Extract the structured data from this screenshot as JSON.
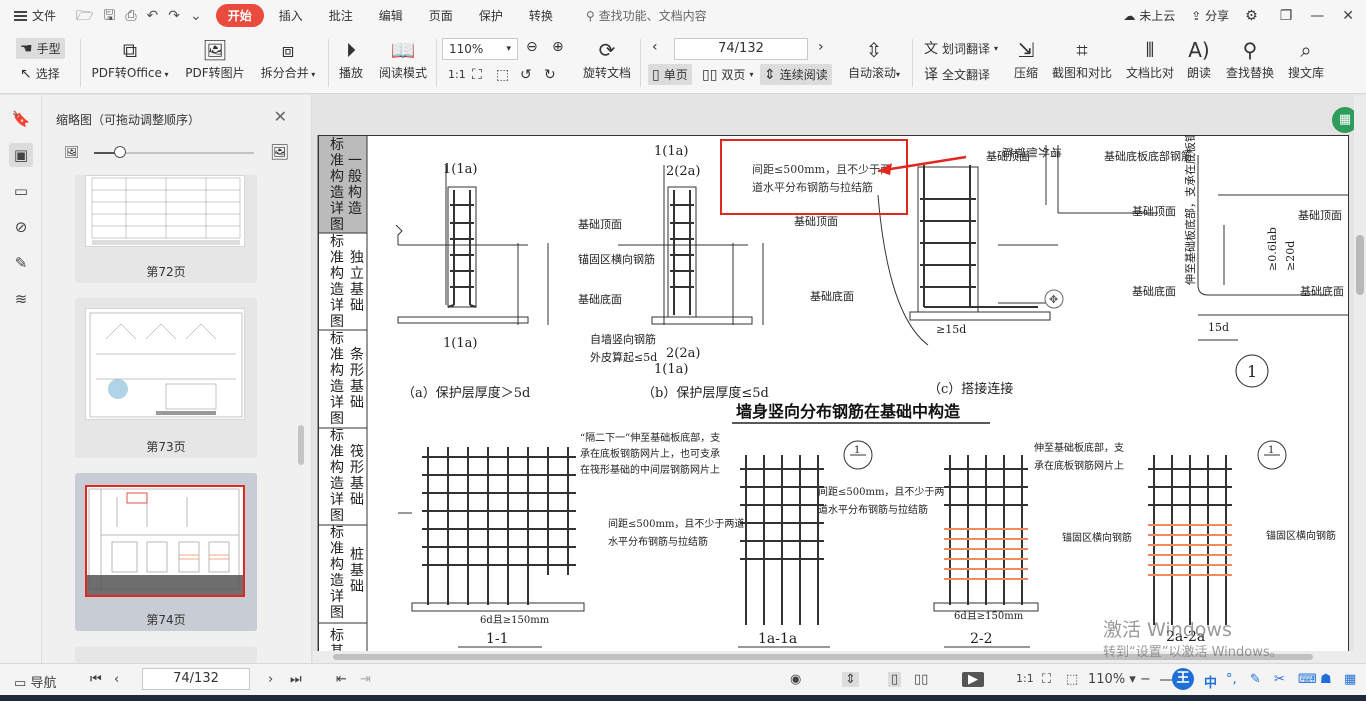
{
  "menubar": {
    "file": "文件",
    "tabs": [
      "开始",
      "插入",
      "批注",
      "编辑",
      "页面",
      "保护",
      "转换"
    ],
    "active_tab": "开始",
    "search_placeholder": "查找功能、文档内容",
    "cloud": "未上云",
    "share": "分享"
  },
  "ribbon": {
    "hand": "手型",
    "select": "选择",
    "pdf_to_office": "PDF转Office",
    "pdf_to_image": "PDF转图片",
    "split_merge": "拆分合并",
    "play": "播放",
    "read_mode": "阅读模式",
    "zoom": "110%",
    "rotate_doc": "旋转文档",
    "page_field": "74/132",
    "single": "单页",
    "double": "双页",
    "continuous": "连续阅读",
    "auto_scroll": "自动滚动",
    "word_translate": "划词翻译",
    "full_translate": "全文翻译",
    "compress": "压缩",
    "screenshot_compare": "截图和对比",
    "doc_compare": "文档比对",
    "read_aloud": "朗读",
    "find_replace": "查找替换",
    "search_lib": "搜文库"
  },
  "thumbnails": {
    "title": "缩略图（可拖动调整顺序）",
    "pages": [
      {
        "label": "第72页",
        "selected": false
      },
      {
        "label": "第73页",
        "selected": false
      },
      {
        "label": "第74页",
        "selected": true
      }
    ]
  },
  "document": {
    "side_column": [
      "标准构造详图",
      "一般构造",
      "标准构造详图",
      "独立基础",
      "标准构造详图",
      "条形基础",
      "标准构造详图",
      "筏形基础",
      "标准构造详图",
      "桩基础",
      "标基"
    ],
    "annotation_box": "间距≤500mm，且不少于两道水平分布钢筋与拉结筋",
    "heading": "墙身竖向分布钢筋在基础中构造",
    "captions": [
      "（a）保护层厚度＞5d",
      "（b）保护层厚度≤5d",
      "（c）搭接连接"
    ],
    "labels": {
      "sec_1a": "1(1a)",
      "sec_2a": "2(2a)",
      "found_top": "基础顶面",
      "found_bottom": "基础底面",
      "anchor_rebar": "锚固区横向钢筋",
      "edge_note_1": "自墙竖向钢筋",
      "edge_note_2": "外皮算起≤5d",
      "base_plate_note": "基础底板底部钢筋",
      "outer_wall": "墙外侧钢筋",
      "extend_note": "伸至基础板底部，支承在底板钢筋网片上",
      "interval_note_1": "间距≤500mm，且不少于两道",
      "interval_note_2": "水平分布钢筋与拉结筋",
      "every_other_1": "“隔二下一”伸至基础板底部，支",
      "every_other_2": "承在底板钢筋网片上，也可支承",
      "every_other_3": "在筏形基础的中间层钢筋网片上",
      "interval2_1": "间距≤500mm，且不少于两",
      "interval2_2": "道水平分布钢筋与拉结筋",
      "extend2_1": "伸至基础板底部，支",
      "extend2_2": "承在底板钢筋网片上",
      "hook_1": "6d且≥150mm",
      "hook_2": "6d且≥150mm",
      "dim_15d": "≥15d",
      "dim_15d_b": "15d",
      "dim_06": "≥0.6lab",
      "dim_20d": "≥20d",
      "circle1": "1",
      "circle_minus": "1",
      "sec_11": "1-1",
      "sec_1a1a": "1a-1a",
      "sec_22": "2-2",
      "sec_2a2a": "2a-2a"
    }
  },
  "statusbar": {
    "nav": "导航",
    "page": "74/132",
    "zoom": "110%"
  },
  "watermark": {
    "line1": "激活 Windows",
    "line2": "转到“设置”以激活 Windows。"
  },
  "colors": {
    "accent": "#e94b3c",
    "annotation_red": "#e0281e",
    "orange_rebar": "#f08a5a"
  }
}
